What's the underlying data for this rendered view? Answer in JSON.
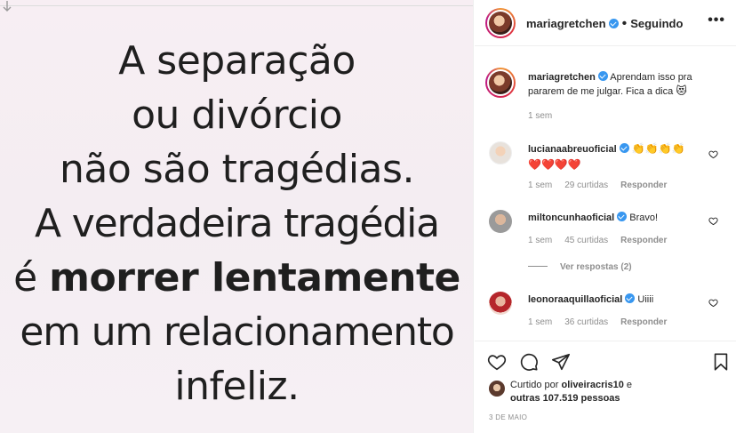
{
  "post": {
    "quote_lines": [
      {
        "text": "A separação",
        "bold": false
      },
      {
        "text": "ou divórcio",
        "bold": false
      },
      {
        "text": "não são tragédias.",
        "bold": false
      },
      {
        "text": "A verdadeira tragédia",
        "bold": false
      },
      {
        "text": "é ",
        "bold": false,
        "bold_part": "morrer lentamente"
      },
      {
        "text": "em um relacionamento",
        "bold": false
      },
      {
        "text": "infeliz.",
        "bold": false
      }
    ]
  },
  "header": {
    "username": "mariagretchen",
    "separator": "•",
    "follow_label": "Seguindo",
    "more_label": "•••"
  },
  "caption": {
    "username": "mariagretchen",
    "text": "Aprendam isso pra pararem de me julgar. Fica a dica",
    "emoji": "😻",
    "time": "1 sem"
  },
  "comments": [
    {
      "username": "lucianaabreuoficial",
      "text": "👏👏👏👏",
      "second_line": "❤️❤️❤️❤️",
      "time": "1 sem",
      "likes": "29 curtidas",
      "reply": "Responder"
    },
    {
      "username": "miltoncunhaoficial",
      "text": "Bravo!",
      "time": "1 sem",
      "likes": "45 curtidas",
      "reply": "Responder",
      "view_replies": "Ver respostas (2)"
    },
    {
      "username": "leonoraaquillaoficial",
      "text": "Uiiii",
      "time": "1 sem",
      "likes": "36 curtidas",
      "reply": "Responder"
    }
  ],
  "likes": {
    "prefix": "Curtido por",
    "user": "oliveiracris10",
    "conj": "e",
    "others": "outras 107.519 pessoas"
  },
  "date": "3 DE MAIO",
  "colors": {
    "verified": "#3897f0",
    "muted": "#8e8e8e",
    "text": "#262626",
    "border": "#efefef"
  }
}
